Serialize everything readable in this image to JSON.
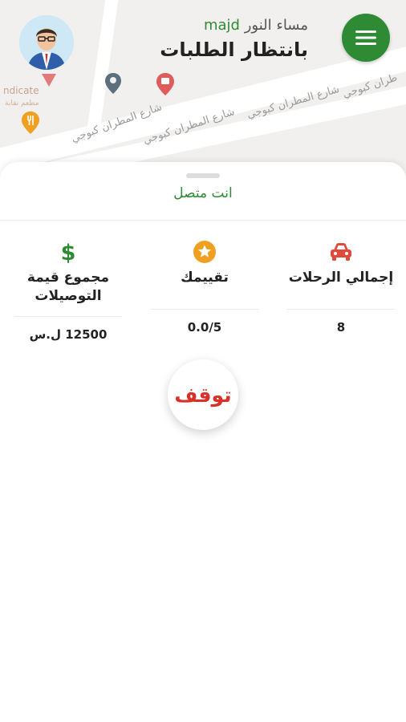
{
  "header": {
    "greeting_prefix": "مساء النور",
    "driver_name": "majd",
    "status_title": "بانتظار الطلبات"
  },
  "map": {
    "poi_label": "ndicate",
    "poi_label_ar": "مطعم نقابة",
    "street_labels": [
      "شارع المطران كبوجي",
      "شارع المطران كبوجي",
      "شارع المطران كبوجي",
      "طران كبوجي"
    ]
  },
  "sheet": {
    "connection_status": "انت متصل",
    "stats": {
      "trips": {
        "label": "إجمالي الرحلات",
        "value": "8",
        "icon": "car-icon"
      },
      "rating": {
        "label": "تقييمك",
        "value": "0.0/5",
        "icon": "star-icon"
      },
      "earnings": {
        "label": "مجموع قيمة التوصيلات",
        "value": "12500 ل.س",
        "icon": "dollar-icon"
      }
    },
    "stop_button": "توقف"
  },
  "colors": {
    "brand_green": "#2e8b34",
    "stop_red": "#d93128",
    "car_red": "#e04a3c",
    "star_orange": "#f0a020"
  }
}
